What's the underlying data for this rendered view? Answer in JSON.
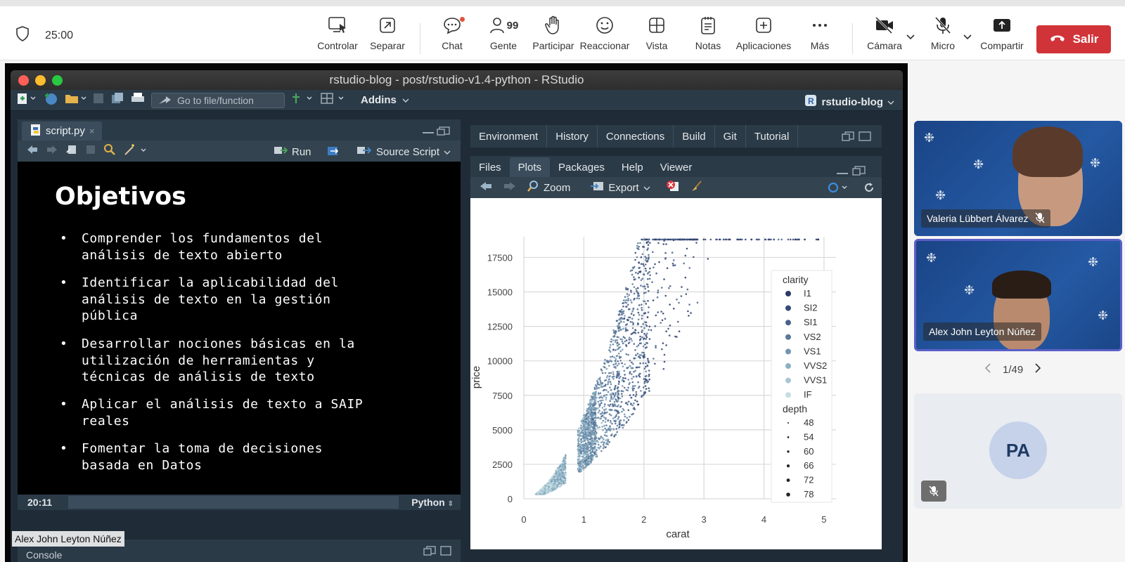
{
  "meeting": {
    "timer": "25:00",
    "toolbar": [
      {
        "id": "controlar",
        "label": "Controlar",
        "icon": "control-screen-icon"
      },
      {
        "id": "separar",
        "label": "Separar",
        "icon": "popout-icon"
      },
      {
        "id": "chat",
        "label": "Chat",
        "icon": "chat-icon"
      },
      {
        "id": "gente",
        "label": "Gente",
        "icon": "people-icon",
        "count": "99"
      },
      {
        "id": "participar",
        "label": "Participar",
        "icon": "raise-hand-icon"
      },
      {
        "id": "reaccionar",
        "label": "Reaccionar",
        "icon": "smiley-icon"
      },
      {
        "id": "vista",
        "label": "Vista",
        "icon": "grid-view-icon"
      },
      {
        "id": "notas",
        "label": "Notas",
        "icon": "notes-icon"
      },
      {
        "id": "aplicaciones",
        "label": "Aplicaciones",
        "icon": "add-apps-icon"
      },
      {
        "id": "mas",
        "label": "Más",
        "icon": "more-icon"
      },
      {
        "id": "camara",
        "label": "Cámara",
        "icon": "camera-off-icon"
      },
      {
        "id": "micro",
        "label": "Micro",
        "icon": "mic-off-icon"
      },
      {
        "id": "compartir",
        "label": "Compartir",
        "icon": "share-icon"
      }
    ],
    "leave_label": "Salir",
    "accent": "#d13438",
    "participants": [
      {
        "name": "Valeria Lübbert Álvarez",
        "muted": true
      },
      {
        "name": "Alex John Leyton Núñez",
        "muted": false,
        "active": true
      }
    ],
    "pager": "1/49",
    "placeholder_tile": {
      "initials": "PA",
      "muted": true
    },
    "speaker_label": "Alex John Leyton Núñez"
  },
  "rstudio": {
    "title": "rstudio-blog - post/rstudio-v1.4-python - RStudio",
    "goto_placeholder": "Go to file/function",
    "addins": "Addins",
    "project": "rstudio-blog",
    "editor_tab": "script.py",
    "run_label": "Run",
    "source_label": "Source Script",
    "cursor_pos": "20:11",
    "language": "Python",
    "console_label": "Console",
    "top_tabs": [
      "Environment",
      "History",
      "Connections",
      "Build",
      "Git",
      "Tutorial"
    ],
    "bottom_tabs": [
      "Files",
      "Plots",
      "Packages",
      "Help",
      "Viewer"
    ],
    "active_bottom_tab": "Plots",
    "zoom_label": "Zoom",
    "export_label": "Export"
  },
  "slide": {
    "heading": "Objetivos",
    "bullets": [
      [
        "Comprender los fundamentos del",
        "análisis de texto abierto"
      ],
      [
        "Identificar la aplicabilidad del",
        "análisis de texto en la gestión",
        "pública"
      ],
      [
        "Desarrollar nociones básicas en la",
        "utilización de herramientas y",
        "técnicas de análisis de texto"
      ],
      [
        "Aplicar el análisis de texto a SAIP",
        "reales"
      ],
      [
        "Fomentar la toma de decisiones",
        "basada en Datos"
      ]
    ]
  },
  "chart_data": {
    "type": "scatter",
    "xlabel": "carat",
    "ylabel": "price",
    "xlim": [
      0,
      5.2
    ],
    "ylim": [
      0,
      19000
    ],
    "x_ticks": [
      0,
      1,
      2,
      3,
      4,
      5
    ],
    "y_ticks": [
      0,
      2500,
      5000,
      7500,
      10000,
      12500,
      15000,
      17500
    ],
    "grid": true,
    "legend_position": "right",
    "color_legend": {
      "title": "clarity",
      "entries": [
        "I1",
        "SI2",
        "SI1",
        "VS2",
        "VS1",
        "VVS2",
        "VVS1",
        "IF"
      ],
      "colors": [
        "#2b3a67",
        "#364a78",
        "#46628a",
        "#5b7a9a",
        "#7395b0",
        "#8cb0c3",
        "#a8c7d3",
        "#c5dde2"
      ]
    },
    "size_legend": {
      "title": "depth",
      "entries": [
        "48",
        "54",
        "60",
        "66",
        "72",
        "78"
      ]
    }
  }
}
